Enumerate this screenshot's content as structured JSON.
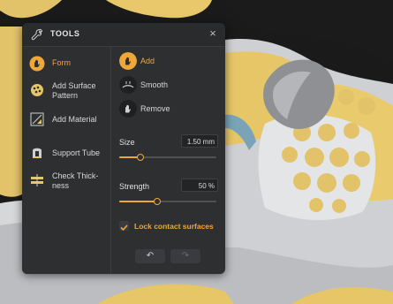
{
  "panel": {
    "title": "TOOLS",
    "close_label": "×",
    "nav": [
      {
        "label": "Form",
        "icon": "form-icon",
        "active": true
      },
      {
        "label": "Add Surface\nPattern",
        "icon": "surface-pattern-icon",
        "active": false
      },
      {
        "label": "Add Material",
        "icon": "add-material-icon",
        "active": false
      },
      {
        "label": "Support Tube",
        "icon": "support-tube-icon",
        "active": false
      },
      {
        "label": "Check Thick-\nness",
        "icon": "check-thickness-icon",
        "active": false
      }
    ],
    "options": [
      {
        "label": "Add",
        "active": true,
        "icon": "add-hand-icon"
      },
      {
        "label": "Smooth",
        "active": false,
        "icon": "smooth-icon"
      },
      {
        "label": "Remove",
        "active": false,
        "icon": "remove-icon"
      }
    ],
    "size": {
      "label": "Size",
      "value": "1.50 mm",
      "level": 0.22
    },
    "strength": {
      "label": "Strength",
      "value": "50 %",
      "level": 0.39
    },
    "lock": {
      "label": "Lock contact surfaces",
      "checked": true
    },
    "undo_label": "↶",
    "redo_label": "↷"
  },
  "colors": {
    "accent": "#f0a73a",
    "panel_bg": "#2e2f31",
    "model_bone": "#e8c86a",
    "model_metal": "#d9dadc"
  }
}
